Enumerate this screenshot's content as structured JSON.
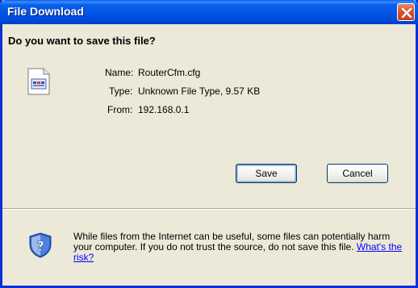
{
  "window": {
    "title": "File Download"
  },
  "dialog": {
    "question": "Do you want to save this file?",
    "file": {
      "name_label": "Name:",
      "name_value": "RouterCfm.cfg",
      "type_label": "Type:",
      "type_value": "Unknown File Type, 9.57 KB",
      "from_label": "From:",
      "from_value": "192.168.0.1"
    },
    "buttons": {
      "save_label": "Save",
      "cancel_label": "Cancel"
    },
    "warning": {
      "text": "While files from the Internet can be useful, some files can potentially harm your computer. If you do not trust the source, do not save this file.",
      "link_label": "What's the risk?"
    }
  },
  "icons": {
    "close": "close-icon",
    "file": "file-icon",
    "shield": "shield-question-icon"
  },
  "colors": {
    "titlebar": "#0055e5",
    "close_button": "#d8542e",
    "dialog_background": "#ece9d8",
    "link": "#0000ff"
  }
}
